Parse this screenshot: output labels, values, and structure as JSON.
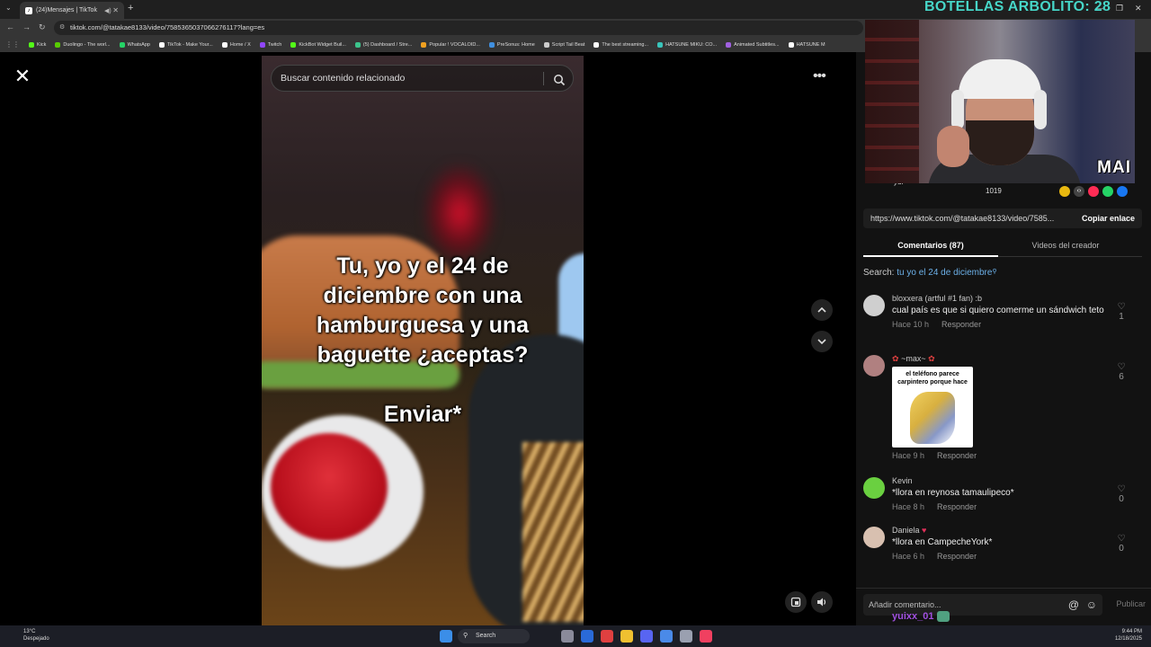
{
  "browser": {
    "tab_title": "(24)Mensajes | TikTok",
    "url": "tiktok.com/@tatakae8133/video/7585365037066276117?lang=es",
    "bookmarks": [
      {
        "label": "Kick",
        "color": "#53fc18"
      },
      {
        "label": "Duolingo - The worl...",
        "color": "#58cc02"
      },
      {
        "label": "WhatsApp",
        "color": "#25d366"
      },
      {
        "label": "TikTok - Make Your...",
        "color": "#ffffff"
      },
      {
        "label": "Home / X",
        "color": "#ffffff"
      },
      {
        "label": "Twitch",
        "color": "#9146ff"
      },
      {
        "label": "KickBot Widget Buil...",
        "color": "#53fc18"
      },
      {
        "label": "(5) Dashboard / Stre...",
        "color": "#3cc48c"
      },
      {
        "label": "Popular ! VOCALOID...",
        "color": "#f0a020"
      },
      {
        "label": "PreSonus: Home",
        "color": "#4090e0"
      },
      {
        "label": "Script Tail Beat",
        "color": "#cccccc"
      },
      {
        "label": "The best streaming...",
        "color": "#ffffff"
      },
      {
        "label": "HATSUNE MIKU: CO...",
        "color": "#39c5bb"
      },
      {
        "label": "Animated Subtitles...",
        "color": "#a060e0"
      },
      {
        "label": "HATSUNE M",
        "color": "#ffffff"
      }
    ]
  },
  "video": {
    "search_placeholder": "Buscar contenido relacionado",
    "caption_lines": [
      "Tu, yo y el 24 de",
      "diciembre con una",
      "hamburguesa y una",
      "baguette ¿aceptas?"
    ],
    "caption_action": "Enviar*"
  },
  "panel": {
    "share_user": "yui",
    "share_count": "1019",
    "link_url": "https://www.tiktok.com/@tatakae8133/video/7585...",
    "copy_label": "Copiar enlace",
    "tab_comments": "Comentarios (87)",
    "tab_creator": "Videos del creador",
    "related_prefix": "Search:",
    "related_query": "tu yo el 24 de diciembre",
    "comments": [
      {
        "user": "bloxxera (artful #1 fan) :b",
        "text": "cual país es que si quiero comerme un sándwich teto",
        "time": "Hace 10 h",
        "reply": "Responder",
        "likes": "1",
        "avatar_color": "#cfcfcf"
      },
      {
        "user": "~max~",
        "text": "",
        "gif_text": "el teléfono parece carpintero porque hace",
        "time": "Hace 9 h",
        "reply": "Responder",
        "likes": "6",
        "avatar_color": "#b08080"
      },
      {
        "user": "Kevin",
        "text": "*llora en reynosa tamaulipeco*",
        "time": "Hace 8 h",
        "reply": "Responder",
        "likes": "0",
        "avatar_color": "#6ad040"
      },
      {
        "user": "Daniela",
        "text": "*llora en CampecheYork*",
        "time": "Hace 6 h",
        "reply": "Responder",
        "likes": "0",
        "avatar_color": "#d8c0b0"
      }
    ],
    "add_comment_placeholder": "Añadir comentario...",
    "publish_label": "Publicar",
    "chat_user": "yuixx_01"
  },
  "stream": {
    "title": "BOTELLAS ARBOLITO: 28",
    "webcam_watermark": "MAI"
  },
  "taskbar": {
    "temp": "13°C",
    "weather": "Despejado",
    "search": "Search",
    "time": "9:44 PM",
    "date": "12/18/2025"
  }
}
